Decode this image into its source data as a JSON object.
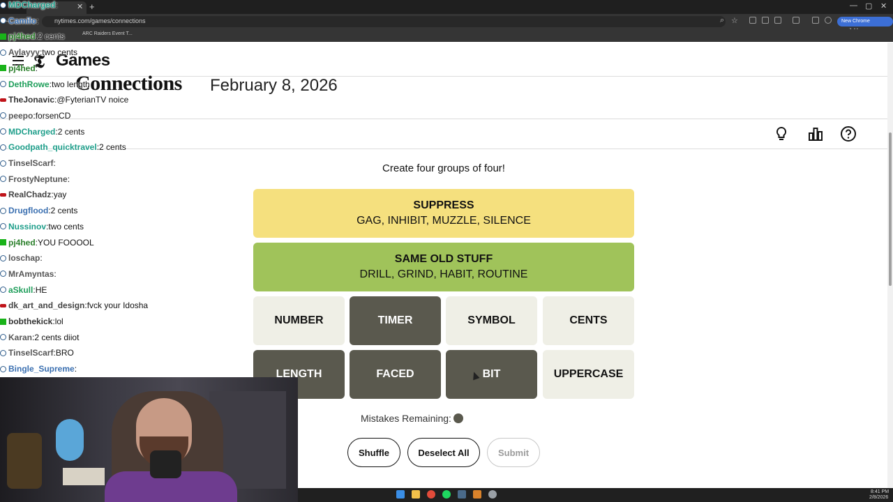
{
  "browser": {
    "url": "nytimes.com/games/connections",
    "bookmark": "ARC Raiders Event T...",
    "update_label": "New Chrome available"
  },
  "site": {
    "brand_letter": "𝕿",
    "brand": "Games",
    "title": "Connections",
    "date": "February 8, 2026"
  },
  "game": {
    "instructions": "Create four groups of four!",
    "solved": [
      {
        "name": "SUPPRESS",
        "members": "GAG, INHIBIT, MUZZLE, SILENCE",
        "color": "#f5e07e"
      },
      {
        "name": "SAME OLD STUFF",
        "members": "DRILL, GRIND, HABIT, ROUTINE",
        "color": "#a0c35a"
      }
    ],
    "tiles": [
      {
        "label": "NUMBER",
        "selected": false
      },
      {
        "label": "TIMER",
        "selected": true
      },
      {
        "label": "SYMBOL",
        "selected": false
      },
      {
        "label": "CENTS",
        "selected": false
      },
      {
        "label": "LENGTH",
        "selected": true
      },
      {
        "label": "FACED",
        "selected": true
      },
      {
        "label": "BIT",
        "selected": true
      },
      {
        "label": "UPPERCASE",
        "selected": false
      }
    ],
    "mistakes_label": "Mistakes Remaining:",
    "mistakes_remaining": 1,
    "shuffle": "Shuffle",
    "deselect": "Deselect All",
    "submit": "Submit"
  },
  "chat": [
    {
      "user": "MDCharged",
      "sep": ":",
      "msg": "",
      "color": "#1e9e8a",
      "icon": "round"
    },
    {
      "user": "Camilo",
      "sep": ":",
      "msg": "",
      "color": "#3a6fb0",
      "icon": "round"
    },
    {
      "user": "pj4hed",
      "sep": ":",
      "msg": "2 cents",
      "color": "#2a7f2a",
      "icon": "green"
    },
    {
      "user": "Aylayyy",
      "sep": ":",
      "msg": "two cents",
      "color": "#555555",
      "icon": "round"
    },
    {
      "user": "pj4hed",
      "sep": ":",
      "msg": "",
      "color": "#2a7f2a",
      "icon": "green"
    },
    {
      "user": "DethRowe",
      "sep": ":",
      "msg": "two length",
      "color": "#1e9e5a",
      "icon": "round"
    },
    {
      "user": "TheJonavic",
      "sep": ":",
      "msg": "@FyterianTV noice",
      "color": "#333333",
      "icon": "red"
    },
    {
      "user": "peepo",
      "sep": ":",
      "msg": "forsenCD",
      "color": "#555555",
      "icon": "round"
    },
    {
      "user": "MDCharged",
      "sep": ":",
      "msg": "2 cents",
      "color": "#1e9e8a",
      "icon": "round"
    },
    {
      "user": "Goodpath_quicktravel",
      "sep": ":",
      "msg": "2 cents",
      "color": "#1e9e8a",
      "icon": "round"
    },
    {
      "user": "TinselScarf",
      "sep": ":",
      "msg": "",
      "color": "#555555",
      "icon": "round"
    },
    {
      "user": "FrostyNeptune",
      "sep": ":",
      "msg": "",
      "color": "#555555",
      "icon": "round"
    },
    {
      "user": "RealChadz",
      "sep": ":",
      "msg": "yay",
      "color": "#444444",
      "icon": "red"
    },
    {
      "user": "Drugflood",
      "sep": ":",
      "msg": "2 cents",
      "color": "#3a6fb0",
      "icon": "round"
    },
    {
      "user": "Nussinov",
      "sep": ":",
      "msg": "two cents",
      "color": "#1e9e8a",
      "icon": "round"
    },
    {
      "user": "pj4hed",
      "sep": ":",
      "msg": "YOU FOOOOL",
      "color": "#2a7f2a",
      "icon": "green"
    },
    {
      "user": "loschap",
      "sep": ":",
      "msg": "",
      "color": "#555555",
      "icon": "round"
    },
    {
      "user": "MrAmyntas",
      "sep": ":",
      "msg": "",
      "color": "#555555",
      "icon": "round"
    },
    {
      "user": "aSkull",
      "sep": ":",
      "msg": "HE",
      "color": "#1e9e5a",
      "icon": "round"
    },
    {
      "user": "dk_art_and_design",
      "sep": ":",
      "msg": "fvck your Idosha",
      "color": "#444444",
      "icon": "red"
    },
    {
      "user": "bobthekick",
      "sep": ":",
      "msg": "lol",
      "color": "#333333",
      "icon": "green"
    },
    {
      "user": "Karan",
      "sep": ":",
      "msg": "2 cents diiot",
      "color": "#555555",
      "icon": "round"
    },
    {
      "user": "TinselScarf",
      "sep": ":",
      "msg": "BRO",
      "color": "#555555",
      "icon": "round"
    },
    {
      "user": "Bingle_Supreme",
      "sep": ":",
      "msg": "",
      "color": "#3a6fb0",
      "icon": "round"
    }
  ],
  "taskbar": {
    "time": "8:41 PM",
    "date": "2/8/2026"
  }
}
